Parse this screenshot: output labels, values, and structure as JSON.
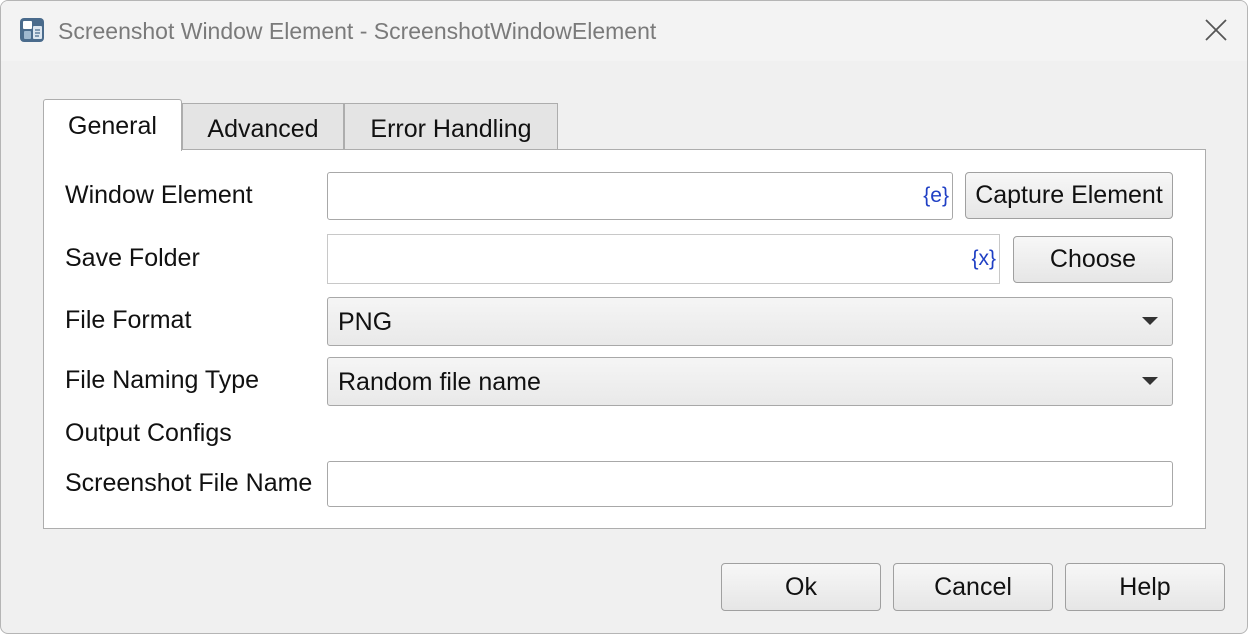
{
  "window": {
    "title": "Screenshot Window Element - ScreenshotWindowElement"
  },
  "tabs": [
    {
      "label": "General",
      "active": true
    },
    {
      "label": "Advanced",
      "active": false
    },
    {
      "label": "Error Handling",
      "active": false
    }
  ],
  "form": {
    "window_element": {
      "label": "Window Element",
      "value": "",
      "badge": "{e}",
      "button": "Capture Element"
    },
    "save_folder": {
      "label": "Save Folder",
      "value": "",
      "badge": "{x}",
      "button": "Choose"
    },
    "file_format": {
      "label": "File Format",
      "value": "PNG"
    },
    "file_naming_type": {
      "label": "File Naming Type",
      "value": "Random file name"
    },
    "output_configs": {
      "label": "Output Configs"
    },
    "screenshot_file_name": {
      "label": "Screenshot File Name",
      "value": ""
    }
  },
  "footer": {
    "ok": "Ok",
    "cancel": "Cancel",
    "help": "Help"
  },
  "colors": {
    "variable_badge": "#1f3fc4",
    "dialog_background": "#f0f0f0"
  },
  "icons": {
    "app": "app-icon",
    "close": "close-icon",
    "dropdown": "chevron-down-icon"
  }
}
